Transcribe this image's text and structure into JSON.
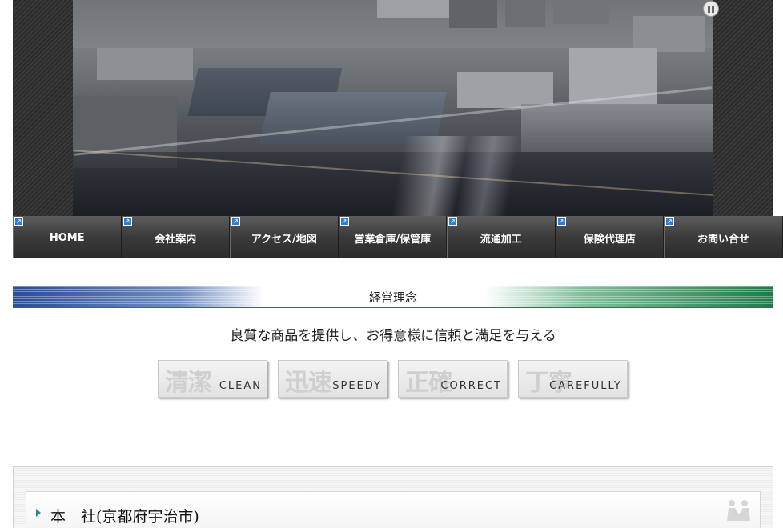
{
  "nav": {
    "items": [
      {
        "label": "HOME"
      },
      {
        "label": "会社案内"
      },
      {
        "label": "アクセス/地図"
      },
      {
        "label": "営業倉庫/保管庫"
      },
      {
        "label": "流通加工"
      },
      {
        "label": "保険代理店"
      },
      {
        "label": "お問い合せ"
      }
    ]
  },
  "philosophy": {
    "title": "経営理念",
    "motto": "良質な商品を提供し、お得意様に信頼と満足を与える",
    "values": [
      {
        "kanji": "清潔",
        "english": "CLEAN"
      },
      {
        "kanji": "迅速",
        "english": "SPEEDY"
      },
      {
        "kanji": "正確",
        "english": "CORRECT"
      },
      {
        "kanji": "丁寧",
        "english": "CAREFULLY"
      }
    ]
  },
  "office": {
    "title": "本　社(京都府宇治市)"
  },
  "colors": {
    "nav_bg": "#3a3a3a",
    "accent_blue": "#2a4d93",
    "accent_green": "#1f7a48"
  }
}
